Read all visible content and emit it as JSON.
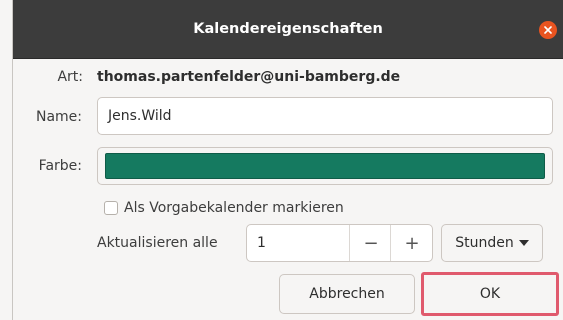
{
  "dialog": {
    "title": "Kalendereigenschaften"
  },
  "form": {
    "type_label": "Art:",
    "type_value": "thomas.partenfelder@uni-bamberg.de",
    "name_label": "Name:",
    "name_value": "Jens.Wild",
    "color_label": "Farbe:",
    "color_value": "#157a60",
    "default_checkbox_label": "Als Vorgabekalender markieren",
    "default_checked": false,
    "refresh_label": "Aktualisieren alle",
    "refresh_value": "1",
    "minus_symbol": "−",
    "plus_symbol": "+",
    "unit_label": "Stunden"
  },
  "buttons": {
    "cancel_label": "Abbrechen",
    "ok_label": "OK"
  },
  "colors": {
    "titlebar": "#3c3c3c",
    "close": "#e95420",
    "highlight": "#e05a6d"
  },
  "icons": {
    "close": "close-icon",
    "dropdown": "caret-down-icon"
  }
}
